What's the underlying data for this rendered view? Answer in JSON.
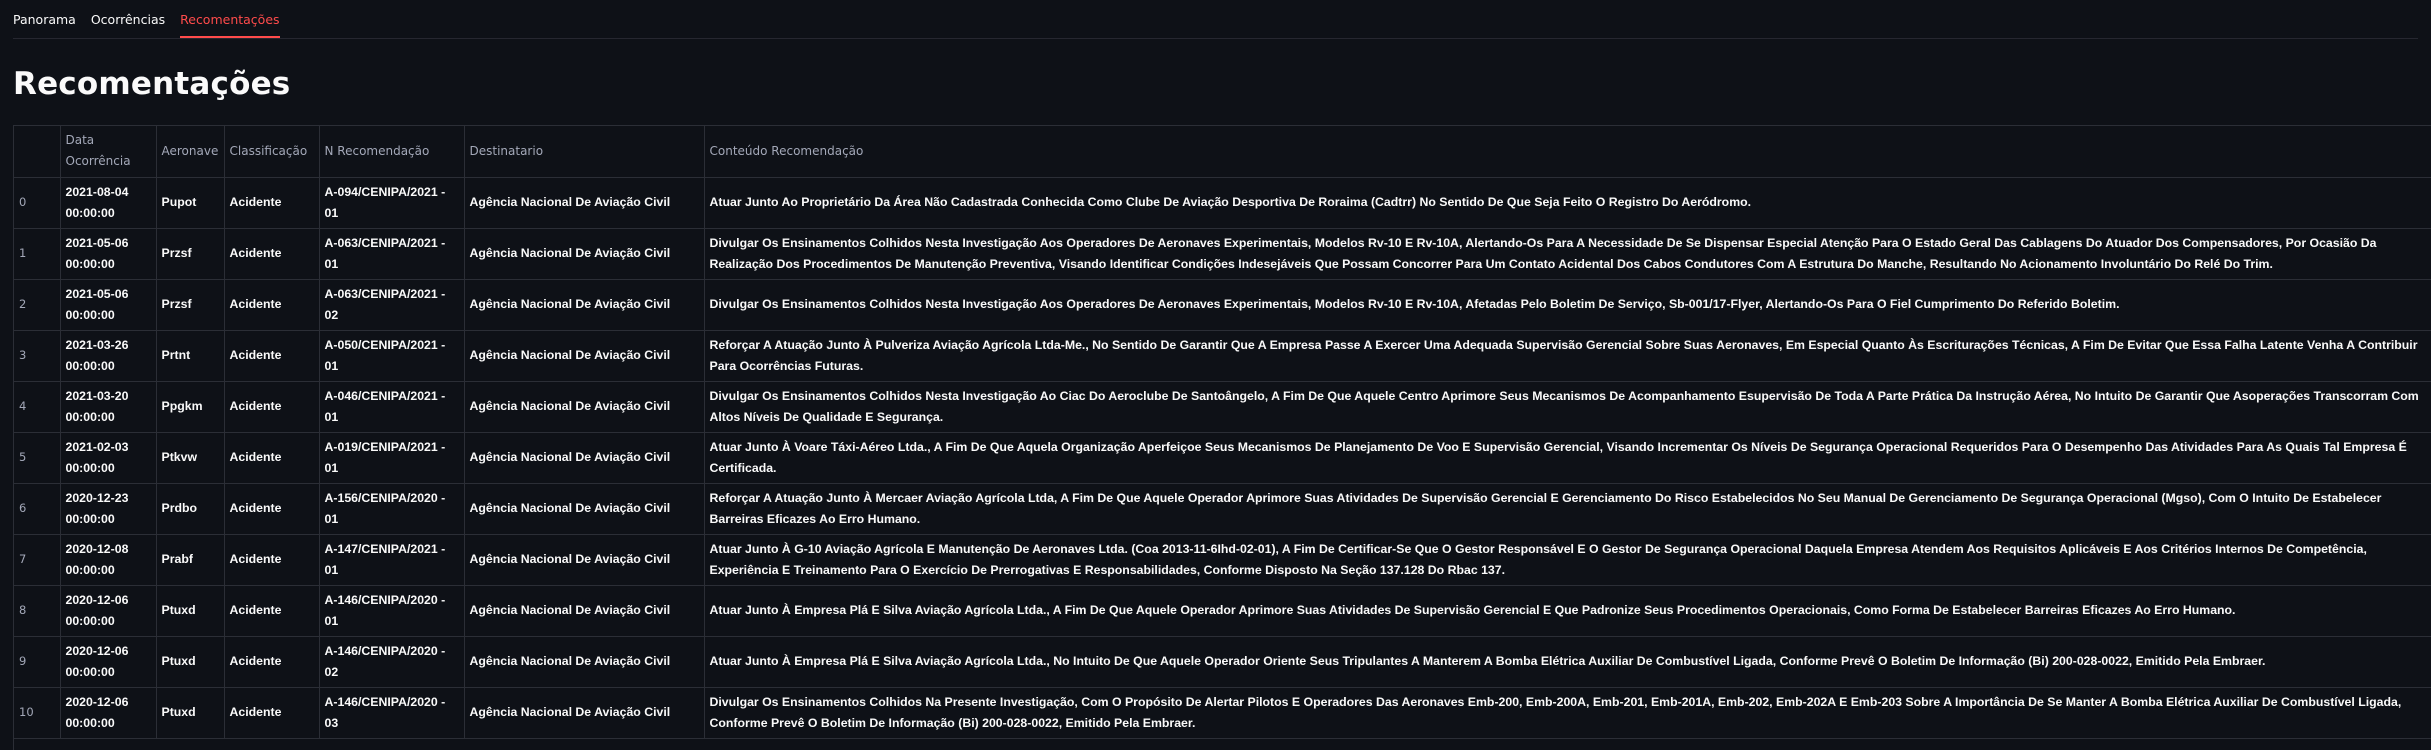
{
  "tabs": [
    {
      "label": "Panorama",
      "active": false
    },
    {
      "label": "Ocorrências",
      "active": false
    },
    {
      "label": "Recomentações",
      "active": true
    }
  ],
  "page_title": "Recomentações",
  "table": {
    "columns": [
      "",
      "Data Ocorrência",
      "Aeronave",
      "Classificação",
      "N Recomendação",
      "Destinatario",
      "Conteúdo Recomendação"
    ],
    "rows": [
      {
        "idx": "0",
        "date": "2021-08-04 00:00:00",
        "aircraft": "Pupot",
        "class": "Acidente",
        "rec": "A-094/CENIPA/2021 - 01",
        "dest": "Agência Nacional De Aviação Civil",
        "content": "Atuar Junto Ao Proprietário Da Área Não Cadastrada Conhecida Como Clube De Aviação Desportiva De Roraima (Cadtrr) No Sentido De Que Seja Feito O Registro Do Aeródromo."
      },
      {
        "idx": "1",
        "date": "2021-05-06 00:00:00",
        "aircraft": "Przsf",
        "class": "Acidente",
        "rec": "A-063/CENIPA/2021 - 01",
        "dest": "Agência Nacional De Aviação Civil",
        "content": "Divulgar Os Ensinamentos Colhidos Nesta Investigação Aos Operadores De Aeronaves Experimentais, Modelos Rv-10 E Rv-10A, Alertando-Os Para A Necessidade De Se Dispensar Especial Atenção Para O Estado Geral Das Cablagens Do Atuador Dos Compensadores, Por Ocasião Da Realização Dos Procedimentos De Manutenção Preventiva, Visando Identificar Condições Indesejáveis Que Possam Concorrer Para Um Contato Acidental Dos Cabos Condutores Com A Estrutura Do Manche, Resultando No Acionamento Involuntário Do Relé Do Trim."
      },
      {
        "idx": "2",
        "date": "2021-05-06 00:00:00",
        "aircraft": "Przsf",
        "class": "Acidente",
        "rec": "A-063/CENIPA/2021 - 02",
        "dest": "Agência Nacional De Aviação Civil",
        "content": "Divulgar Os Ensinamentos Colhidos Nesta Investigação Aos Operadores De Aeronaves Experimentais, Modelos Rv-10 E Rv-10A, Afetadas Pelo Boletim De Serviço, Sb-001/17-Flyer, Alertando-Os Para O Fiel Cumprimento Do Referido Boletim."
      },
      {
        "idx": "3",
        "date": "2021-03-26 00:00:00",
        "aircraft": "Prtnt",
        "class": "Acidente",
        "rec": "A-050/CENIPA/2021 - 01",
        "dest": "Agência Nacional De Aviação Civil",
        "content": "Reforçar A Atuação Junto À Pulveriza Aviação Agrícola Ltda-Me., No Sentido De Garantir Que A Empresa Passe A Exercer Uma Adequada Supervisão Gerencial Sobre Suas Aeronaves, Em Especial Quanto Às Escriturações Técnicas, A Fim De Evitar Que Essa Falha Latente Venha A Contribuir Para Ocorrências Futuras."
      },
      {
        "idx": "4",
        "date": "2021-03-20 00:00:00",
        "aircraft": "Ppgkm",
        "class": "Acidente",
        "rec": "A-046/CENIPA/2021 - 01",
        "dest": "Agência Nacional De Aviação Civil",
        "content": "Divulgar Os Ensinamentos Colhidos Nesta Investigação Ao Ciac Do Aeroclube De Santoângelo, A Fim De Que Aquele Centro Aprimore Seus Mecanismos De Acompanhamento Esupervisão De Toda A Parte Prática Da Instrução Aérea, No Intuito De Garantir Que Asoperações Transcorram Com Altos Níveis De Qualidade E Segurança."
      },
      {
        "idx": "5",
        "date": "2021-02-03 00:00:00",
        "aircraft": "Ptkvw",
        "class": "Acidente",
        "rec": "A-019/CENIPA/2021 - 01",
        "dest": "Agência Nacional De Aviação Civil",
        "content": "Atuar Junto À Voare Táxi-Aéreo Ltda., A Fim De Que Aquela Organização Aperfeiçoe Seus Mecanismos De Planejamento De Voo E Supervisão Gerencial, Visando Incrementar Os Níveis De Segurança Operacional Requeridos Para O Desempenho Das Atividades Para As Quais Tal Empresa É Certificada."
      },
      {
        "idx": "6",
        "date": "2020-12-23 00:00:00",
        "aircraft": "Prdbo",
        "class": "Acidente",
        "rec": "A-156/CENIPA/2020 - 01",
        "dest": "Agência Nacional De Aviação Civil",
        "content": "Reforçar A Atuação Junto À Mercaer Aviação Agrícola Ltda, A Fim De Que Aquele Operador Aprimore Suas Atividades De Supervisão Gerencial E Gerenciamento Do Risco Estabelecidos No Seu Manual De Gerenciamento De Segurança Operacional (Mgso), Com O Intuito De Estabelecer Barreiras Eficazes Ao Erro Humano."
      },
      {
        "idx": "7",
        "date": "2020-12-08 00:00:00",
        "aircraft": "Prabf",
        "class": "Acidente",
        "rec": "A-147/CENIPA/2021 - 01",
        "dest": "Agência Nacional De Aviação Civil",
        "content": "Atuar Junto À G-10 Aviação Agrícola E Manutenção De Aeronaves Ltda. (Coa 2013-11-6Ihd-02-01), A Fim De Certificar-Se Que O Gestor Responsável E O Gestor De Segurança Operacional Daquela Empresa Atendem Aos Requisitos Aplicáveis E Aos Critérios Internos De Competência, Experiência E Treinamento Para O Exercício De Prerrogativas E Responsabilidades, Conforme Disposto Na Seção 137.128 Do Rbac 137."
      },
      {
        "idx": "8",
        "date": "2020-12-06 00:00:00",
        "aircraft": "Ptuxd",
        "class": "Acidente",
        "rec": "A-146/CENIPA/2020 - 01",
        "dest": "Agência Nacional De Aviação Civil",
        "content": "Atuar Junto À Empresa Plá E Silva Aviação Agrícola Ltda., A Fim De Que Aquele Operador Aprimore Suas Atividades De Supervisão Gerencial E Que Padronize Seus Procedimentos Operacionais, Como Forma De Estabelecer Barreiras Eficazes Ao Erro Humano."
      },
      {
        "idx": "9",
        "date": "2020-12-06 00:00:00",
        "aircraft": "Ptuxd",
        "class": "Acidente",
        "rec": "A-146/CENIPA/2020 - 02",
        "dest": "Agência Nacional De Aviação Civil",
        "content": "Atuar Junto À Empresa Plá E Silva Aviação Agrícola Ltda., No Intuito De Que Aquele Operador Oriente Seus Tripulantes A Manterem A Bomba Elétrica Auxiliar De Combustível Ligada, Conforme Prevê O Boletim De Informação (Bi) 200-028-0022, Emitido Pela Embraer."
      },
      {
        "idx": "10",
        "date": "2020-12-06 00:00:00",
        "aircraft": "Ptuxd",
        "class": "Acidente",
        "rec": "A-146/CENIPA/2020 - 03",
        "dest": "Agência Nacional De Aviação Civil",
        "content": "Divulgar Os Ensinamentos Colhidos Na Presente Investigação, Com O Propósito De Alertar Pilotos E Operadores Das Aeronaves Emb-200, Emb-200A, Emb-201, Emb-201A, Emb-202, Emb-202A E Emb-203 Sobre A Importância De Se Manter A Bomba Elétrica Auxiliar De Combustível Ligada, Conforme Prevê O Boletim De Informação (Bi) 200-028-0022, Emitido Pela Embraer."
      }
    ]
  },
  "colors": {
    "background": "#0e1117",
    "accent": "#ff4b4b",
    "grid": "#2b2e36",
    "header_text": "#a3a8b8",
    "text": "#fafafa"
  }
}
